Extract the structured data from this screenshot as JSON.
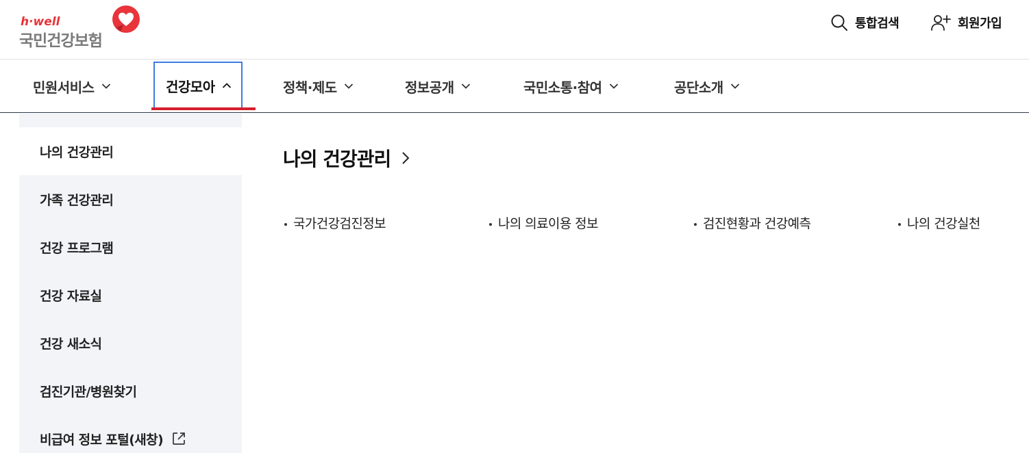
{
  "header": {
    "logo": {
      "brand": "h·well",
      "name": "국민건강보험"
    },
    "search_label": "통합검색",
    "join_label": "회원가입",
    "icons": {
      "search": "search-icon",
      "join": "user-plus-icon"
    }
  },
  "gnb": {
    "items": [
      {
        "label": "민원서비스",
        "state": "collapsed"
      },
      {
        "label": "건강모아",
        "state": "expanded"
      },
      {
        "label": "정책·제도",
        "state": "collapsed"
      },
      {
        "label": "정보공개",
        "state": "collapsed"
      },
      {
        "label": "국민소통·참여",
        "state": "collapsed"
      },
      {
        "label": "공단소개",
        "state": "collapsed"
      }
    ]
  },
  "sidebar": {
    "items": [
      {
        "label": "나의 건강관리",
        "active": true
      },
      {
        "label": "가족 건강관리"
      },
      {
        "label": "건강 프로그램"
      },
      {
        "label": "건강 자료실"
      },
      {
        "label": "건강 새소식"
      },
      {
        "label": "검진기관/병원찾기"
      },
      {
        "label": "비급여 정보 포털(새창)",
        "icon": "external-link-icon"
      }
    ]
  },
  "main": {
    "title": "나의 건강관리",
    "links": [
      "국가건강검진정보",
      "나의 의료이용 정보",
      "검진현황과 건강예측",
      "나의 건강실천"
    ]
  },
  "colors": {
    "accent_red": "#d51d2e",
    "focus_blue": "#3c7be0",
    "sidebar_bg": "#f3f4f8"
  }
}
